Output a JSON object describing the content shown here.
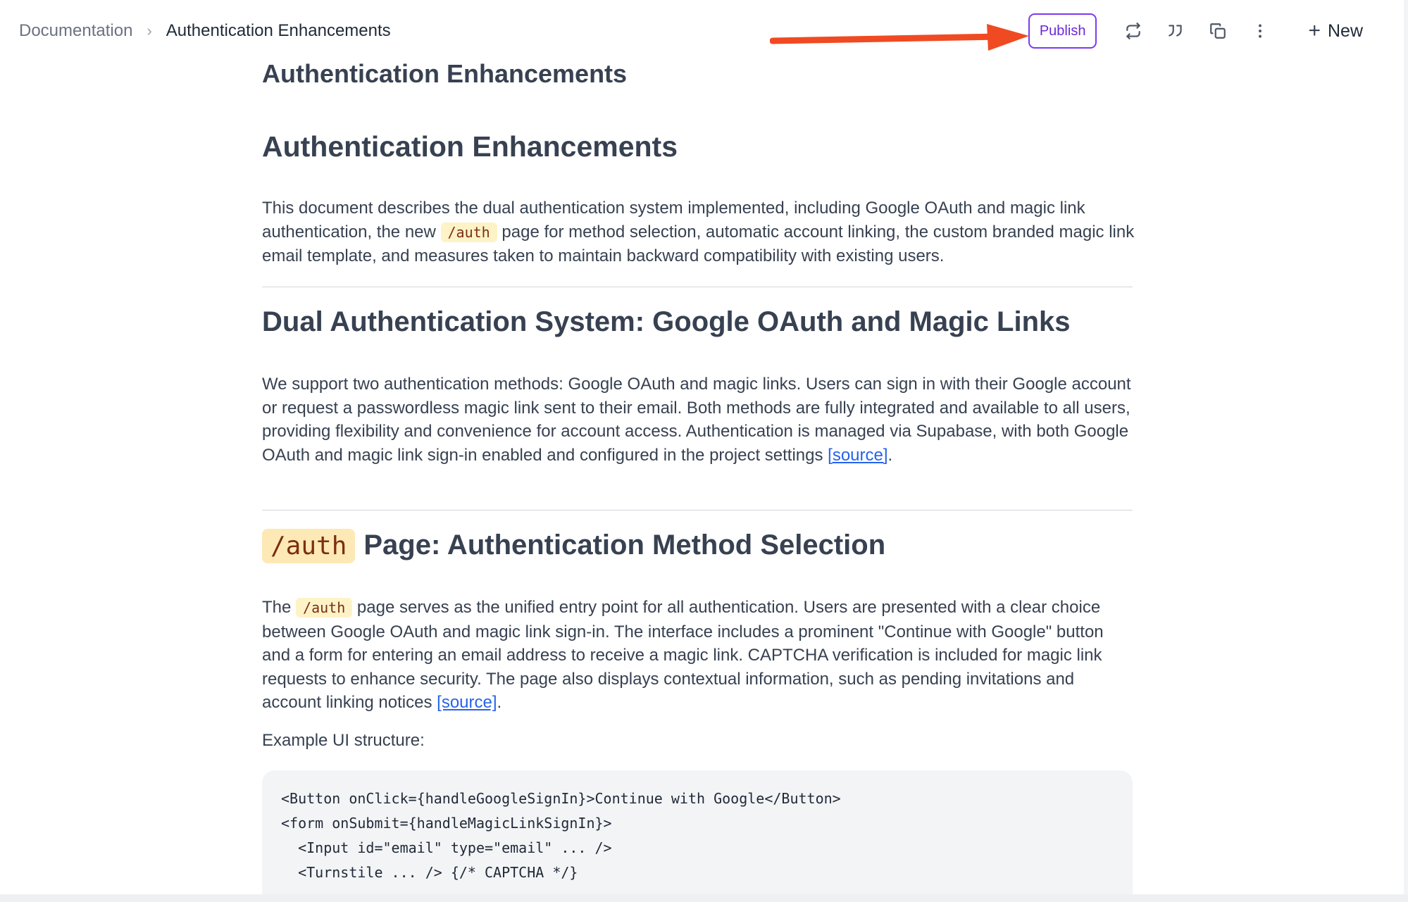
{
  "breadcrumb": {
    "root": "Documentation",
    "separator": "›",
    "current": "Authentication Enhancements"
  },
  "toolbar": {
    "publish_label": "Publish",
    "new_label": "New",
    "icons": [
      "sync-icon",
      "quote-icon",
      "copy-icon",
      "more-vertical-icon",
      "plus-icon"
    ]
  },
  "annotation": {
    "arrow_color": "#f04a23"
  },
  "doc": {
    "clipped_title": "Authentication Enhancements",
    "title": "Authentication Enhancements",
    "intro_1": "This document describes the dual authentication system implemented, including Google OAuth and magic link authentication, the new ",
    "intro_code": "/auth",
    "intro_2": " page for method selection, automatic account linking, the custom branded magic link email template, and measures taken to maintain backward compatibility with existing users.",
    "section1_heading": "Dual Authentication System: Google OAuth and Magic Links",
    "section1_body": "We support two authentication methods: Google OAuth and magic links. Users can sign in with their Google account or request a passwordless magic link sent to their email. Both methods are fully integrated and available to all users, providing flexibility and convenience for account access. Authentication is managed via Supabase, with both Google OAuth and magic link sign-in enabled and configured in the project settings ",
    "section1_link": "[source]",
    "section1_end": ".",
    "section2_heading_code": "/auth",
    "section2_heading_text": "Page: Authentication Method Selection",
    "section2_p1_a": "The ",
    "section2_p1_code": "/auth",
    "section2_p1_b": " page serves as the unified entry point for all authentication. Users are presented with a clear choice between Google OAuth and magic link sign-in. The interface includes a prominent \"Continue with Google\" button and a form for entering an email address to receive a magic link. CAPTCHA verification is included for magic link requests to enhance security. The page also displays contextual information, such as pending invitations and account linking notices ",
    "section2_link": "[source]",
    "section2_end": ".",
    "example_label": "Example UI structure:",
    "code_lines": [
      "<Button onClick={handleGoogleSignIn}>Continue with Google</Button>",
      "<form onSubmit={handleMagicLinkSignIn}>",
      "  <Input id=\"email\" type=\"email\" ... />",
      "  <Turnstile ... /> {/* CAPTCHA */}"
    ]
  },
  "colors": {
    "accent_purple": "#7c3aed",
    "link_blue": "#2563eb",
    "inline_code_bg": "#fef3c7"
  }
}
